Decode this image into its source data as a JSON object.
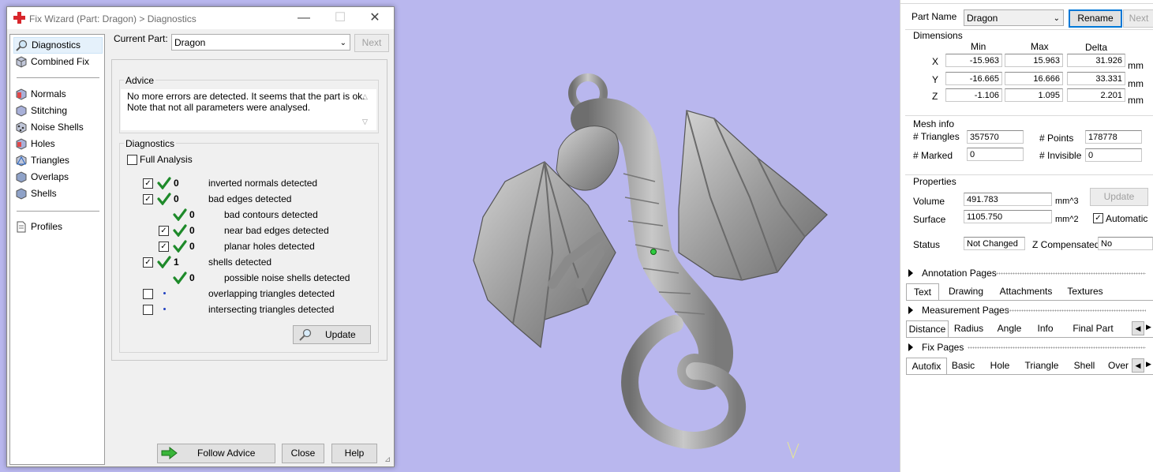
{
  "dialog": {
    "title": "Fix Wizard (Part: Dragon) > Diagnostics",
    "nav": {
      "items_top": [
        "Diagnostics",
        "Combined Fix"
      ],
      "items_mid": [
        "Normals",
        "Stitching",
        "Noise Shells",
        "Holes",
        "Triangles",
        "Overlaps",
        "Shells"
      ],
      "items_bottom": [
        "Profiles"
      ]
    },
    "current_part_label": "Current Part:",
    "current_part_value": "Dragon",
    "next_label": "Next",
    "advice_label": "Advice",
    "advice_text_1": "No more errors are detected. It seems that the part is ok.",
    "advice_text_2": "Note that not all parameters were analysed.",
    "diagnostics_label": "Diagnostics",
    "full_analysis_label": "Full Analysis",
    "rows": [
      {
        "checked": true,
        "ok": true,
        "count": "0",
        "label": "inverted normals detected"
      },
      {
        "checked": true,
        "ok": true,
        "count": "0",
        "label": "bad edges detected"
      },
      {
        "checked": null,
        "ok": true,
        "count": "0",
        "label": "bad contours detected"
      },
      {
        "checked": true,
        "ok": true,
        "count": "0",
        "label": "near bad edges detected"
      },
      {
        "checked": true,
        "ok": true,
        "count": "0",
        "label": "planar holes detected"
      },
      {
        "checked": true,
        "ok": true,
        "count": "1",
        "label": "shells detected"
      },
      {
        "checked": null,
        "ok": true,
        "count": "0",
        "label": "possible noise shells detected"
      },
      {
        "checked": false,
        "ok": false,
        "count": "",
        "label": "overlapping triangles detected"
      },
      {
        "checked": false,
        "ok": false,
        "count": "",
        "label": "intersecting triangles detected"
      }
    ],
    "update_label": "Update",
    "follow_advice_label": "Follow Advice",
    "close_label": "Close",
    "help_label": "Help"
  },
  "panel": {
    "part_name_label": "Part Name",
    "part_name_value": "Dragon",
    "rename_label": "Rename",
    "next_label": "Next",
    "dimensions_label": "Dimensions",
    "col_min": "Min",
    "col_max": "Max",
    "col_delta": "Delta",
    "dims": [
      {
        "axis": "X",
        "min": "-15.963",
        "max": "15.963",
        "delta": "31.926",
        "unit": "mm"
      },
      {
        "axis": "Y",
        "min": "-16.665",
        "max": "16.666",
        "delta": "33.331",
        "unit": "mm"
      },
      {
        "axis": "Z",
        "min": "-1.106",
        "max": "1.095",
        "delta": "2.201",
        "unit": "mm"
      }
    ],
    "mesh_info_label": "Mesh info",
    "triangles_label": "# Triangles",
    "triangles_value": "357570",
    "points_label": "# Points",
    "points_value": "178778",
    "marked_label": "# Marked",
    "marked_value": "0",
    "invisible_label": "# Invisible",
    "invisible_value": "0",
    "properties_label": "Properties",
    "volume_label": "Volume",
    "volume_value": "491.783",
    "volume_unit": "mm^3",
    "surface_label": "Surface",
    "surface_value": "1105.750",
    "surface_unit": "mm^2",
    "update_label": "Update",
    "automatic_label": "Automatic",
    "status_label": "Status",
    "status_value": "Not Changed",
    "zcomp_label": "Z Compensated",
    "zcomp_value": "No",
    "annotation_pages": "Annotation Pages",
    "annotation_tabs": [
      "Text",
      "Drawing",
      "Attachments",
      "Textures"
    ],
    "measurement_pages": "Measurement Pages",
    "measurement_tabs": [
      "Distance",
      "Radius",
      "Angle",
      "Info",
      "Final Part"
    ],
    "fix_pages": "Fix Pages",
    "fix_tabs": [
      "Autofix",
      "Basic",
      "Hole",
      "Triangle",
      "Shell",
      "Over"
    ]
  }
}
